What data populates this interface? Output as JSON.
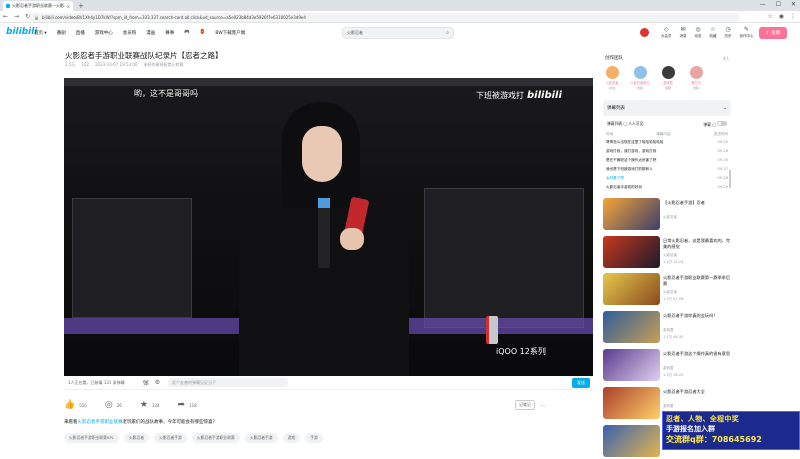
{
  "browser": {
    "tab_title": "火影忍者手游职业联赛—火影...",
    "url": "bilibili.com/video/BV1Xh4y1D7kW/?spm_id_from=333.337.search-card.all.click&vd_source=a5e023b84d3e5926f7e6310025e3d9e4",
    "new_tab": "+",
    "win_min": "—",
    "win_max": "☐",
    "win_close": "✕"
  },
  "header": {
    "logo": "bilibili",
    "nav": [
      "首页 ▾",
      "番剧",
      "直播",
      "游戏中心",
      "会员购",
      "漫画",
      "赛事",
      "🎮",
      "🏮",
      "BW下载客户端"
    ],
    "search_query": "火影忍者",
    "icons": [
      {
        "label": "大会员",
        "glyph": "◇"
      },
      {
        "label": "消息",
        "glyph": "✉"
      },
      {
        "label": "动态",
        "glyph": "◎"
      },
      {
        "label": "收藏",
        "glyph": "☆"
      },
      {
        "label": "历史",
        "glyph": "◷"
      },
      {
        "label": "创作中心",
        "glyph": "✎"
      }
    ],
    "upload_label": "投稿"
  },
  "video": {
    "title": "火影忍者手游职业联赛战队纪录片【忍者之路】",
    "meta": [
      "1.5万",
      "162",
      "2023-10-07 19:53:00",
      "未经作者授权禁止转载"
    ],
    "subtitle": "哟，这不是哥哥吗",
    "watermark_text": "下班被游戏打",
    "watermark_logo": "bilibili",
    "ad_brand": "iQOO 12系列"
  },
  "danmaku_bar": {
    "viewers": "1人正在看，已装填 131 条弹幕",
    "input_placeholder": "发个友善的弹幕见证当下",
    "send_label": "发送"
  },
  "actions": {
    "like": "516",
    "coin": "26",
    "favorite": "134",
    "share": "118",
    "right_label": "记笔记",
    "right_more": "···"
  },
  "description": {
    "prefix": "来看看",
    "highlight": "火影忍者手游职业联赛",
    "suffix": "老玩家们的战队故事，今年可能会有哪些惊喜？"
  },
  "tags": [
    "火影忍者手游职业联赛KPL",
    "火影忍者",
    "火影忍者手游",
    "火影忍者手游职业联赛",
    "火影忍者手游",
    "游戏",
    "手游"
  ],
  "cocreate": {
    "title": "创作团队",
    "count": "4人",
    "members": [
      {
        "name": "火影忍者",
        "role": "UP主",
        "color": "#f5b066"
      },
      {
        "name": "火影忍者官方",
        "role": "出镜",
        "color": "#8fc0e8"
      },
      {
        "name": "游戏君",
        "role": "剪辑",
        "color": "#3c3c3c"
      },
      {
        "name": "鬼灯月",
        "role": "出镜",
        "color": "#e9a5a5"
      }
    ]
  },
  "danmaku_list": {
    "title": "弹幕列表",
    "subtitle": "弹幕列表  ▢ 人人可见",
    "toggle_label": "弹幕 ▢",
    "cols": [
      "时间",
      "弹幕内容",
      "发送时间"
    ],
    "rows": [
      {
        "text": "哥哥怎么出现在这里了哈哈哈哈哈哈",
        "time": "09-25"
      },
      {
        "text": "游戏打我，我打游戏，游戏打我",
        "time": "09-26"
      },
      {
        "text": "是在干嘛呢这个操作太厉害了吧",
        "time": "09-26"
      },
      {
        "text": "我也是下班被游戏打的那种人",
        "time": "09-27"
      },
      {
        "text": "太好看了吧",
        "time": "09-28"
      },
      {
        "text": "火影忍者手游真的好玩",
        "time": "09-29"
      }
    ]
  },
  "recommendations": [
    {
      "title": "【火影忍者手游】忍者",
      "author": "火影忍者",
      "stats": "",
      "colors": [
        "#f4a536",
        "#3d3e6b"
      ]
    },
    {
      "title": "日常火影忍者，这是我最喜欢的，完美的感觉",
      "author": "火影忍者",
      "stats": "1.1万  14-24",
      "colors": [
        "#c8381f",
        "#1c1b2b"
      ]
    },
    {
      "title": "火影忍者手游职业联赛第一赛季季后赛",
      "author": "火影忍者",
      "stats": "1.7万  07-08",
      "colors": [
        "#e6c84c",
        "#8a4a1e"
      ]
    },
    {
      "title": "火影忍者手游你真的会玩吗？",
      "author": "游戏君",
      "stats": "1.1万  06-30",
      "colors": [
        "#2e5e9a",
        "#c89e55"
      ]
    },
    {
      "title": "火影忍者手游这个操作真的很有意思",
      "author": "游戏君",
      "stats": "1.3万  16-20",
      "colors": [
        "#5b3a8c",
        "#e0d0f0"
      ]
    },
    {
      "title": "火影忍者手游忍者大全",
      "author": "游戏君",
      "stats": "8.6万  10-19",
      "colors": [
        "#ab3f2b",
        "#ffd06b"
      ]
    },
    {
      "title": "",
      "author": "",
      "stats": "",
      "colors": [
        "#3b62b0",
        "#e1b450"
      ]
    }
  ],
  "overlay_ad": {
    "line1": "忍者、人物、全程中奖",
    "line2": "手游报名加入群",
    "line3": "交流群q群：708645692"
  }
}
